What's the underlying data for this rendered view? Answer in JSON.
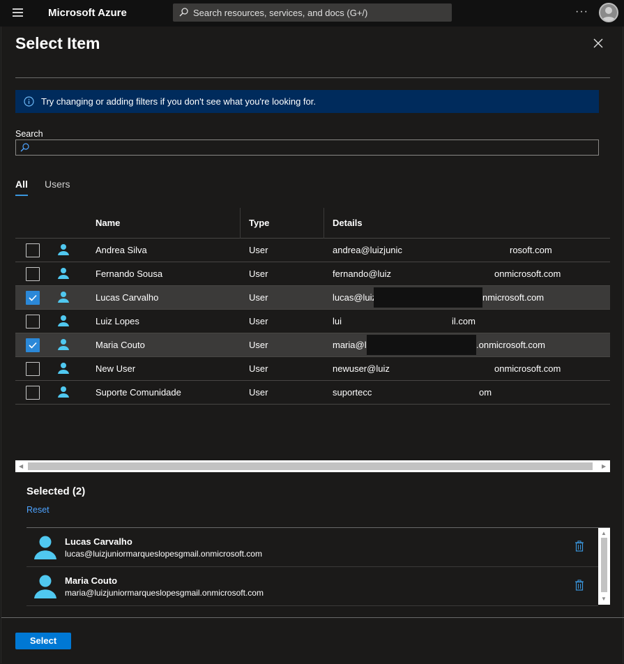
{
  "topbar": {
    "brand": "Microsoft Azure",
    "search_placeholder": "Search resources, services, and docs (G+/)",
    "more_label": "···"
  },
  "panel": {
    "title": "Select Item",
    "info_text": "Try changing or adding filters if you don't see what you're looking for.",
    "search_label": "Search",
    "search_value": "",
    "tabs": [
      {
        "label": "All",
        "active": true
      },
      {
        "label": "Users",
        "active": false
      }
    ]
  },
  "table": {
    "headers": {
      "name": "Name",
      "type": "Type",
      "details": "Details"
    },
    "rows": [
      {
        "name": "Andrea Silva",
        "type": "User",
        "details_start": "andrea@luizjunic",
        "details_end": "rosoft.com",
        "checked": false
      },
      {
        "name": "Fernando Sousa",
        "type": "User",
        "details_start": "fernando@luiz",
        "details_end": "onmicrosoft.com",
        "checked": false
      },
      {
        "name": "Lucas Carvalho",
        "type": "User",
        "details_start": "lucas@luiz",
        "details_end": "nmicrosoft.com",
        "checked": true
      },
      {
        "name": "Luiz Lopes",
        "type": "User",
        "details_start": "lui",
        "details_end": "il.com",
        "checked": false
      },
      {
        "name": "Maria Couto",
        "type": "User",
        "details_start": "maria@lu",
        "details_end": ".onmicrosoft.com",
        "checked": true
      },
      {
        "name": "New User",
        "type": "User",
        "details_start": "newuser@luiz",
        "details_end": "onmicrosoft.com",
        "checked": false
      },
      {
        "name": "Suporte Comunidade",
        "type": "User",
        "details_start": "suportecc",
        "details_end": "om",
        "checked": false
      }
    ]
  },
  "selected": {
    "title": "Selected (2)",
    "reset_label": "Reset",
    "items": [
      {
        "name": "Lucas Carvalho",
        "email": "lucas@luizjuniormarqueslopesgmail.onmicrosoft.com"
      },
      {
        "name": "Maria Couto",
        "email": "maria@luizjuniormarqueslopesgmail.onmicrosoft.com"
      }
    ]
  },
  "footer": {
    "select_label": "Select"
  },
  "colors": {
    "accent": "#0078d4",
    "info_bg": "#002b5c",
    "user_icon": "#50c8f0",
    "selected_row": "#3b3a39",
    "link": "#4da3ff"
  }
}
